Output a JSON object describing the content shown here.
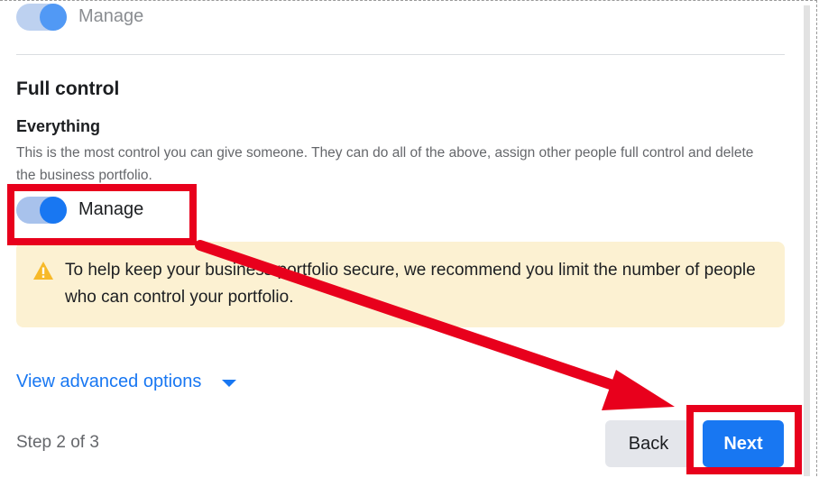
{
  "top_toggle": {
    "label": "Manage",
    "state": "on"
  },
  "full_control": {
    "section_title": "Full control",
    "permission_title": "Everything",
    "permission_description": "This is the most control you can give someone. They can do all of the above, assign other people full control and delete the business portfolio.",
    "toggle": {
      "label": "Manage",
      "state": "on"
    }
  },
  "warning": {
    "icon": "warning-triangle-icon",
    "text": "To help keep your business portfolio secure, we recommend you limit the number of people who can control your portfolio."
  },
  "advanced_options": {
    "label": "View advanced options",
    "icon": "caret-down-icon"
  },
  "footer": {
    "step_text": "Step 2 of 3",
    "back_label": "Back",
    "next_label": "Next"
  },
  "colors": {
    "accent": "#1877f2",
    "toggle_track": "#a8c2ec",
    "warning_bg": "#fcf1d2",
    "warning_icon": "#f7b928",
    "annotation_red": "#e8001c"
  }
}
